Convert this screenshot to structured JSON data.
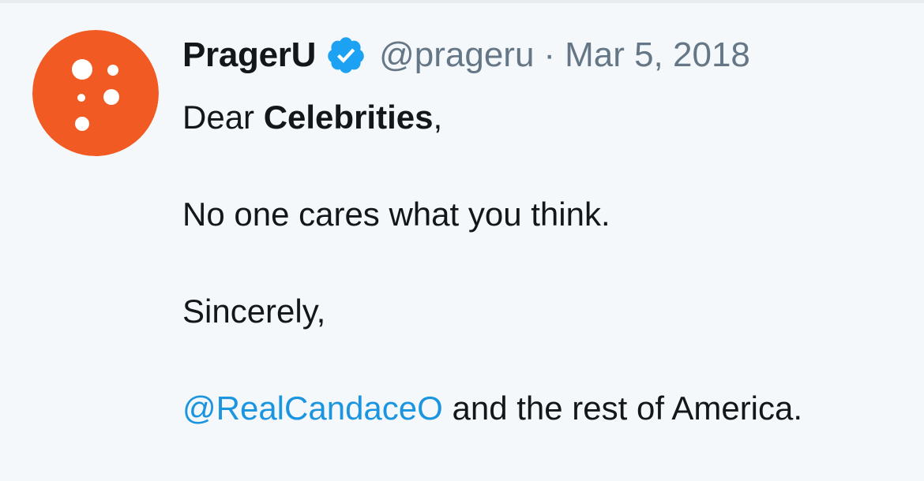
{
  "tweet": {
    "author": {
      "display_name": "PragerU",
      "handle": "@prageru",
      "verified": true,
      "verified_icon": "verified-badge-icon",
      "avatar_icon": "prageru-logo-icon",
      "avatar_color": "#f15a22"
    },
    "separator": "·",
    "date": "Mar 5, 2018",
    "body": {
      "line1_prefix": "Dear ",
      "line1_bold": "Celebrities",
      "line1_suffix": ",",
      "line2": "No one cares what you think.",
      "line3": "Sincerely,",
      "line4_mention": "@RealCandaceO",
      "line4_suffix": " and the rest of America."
    }
  },
  "colors": {
    "background": "#f5f8fa",
    "text": "#14171a",
    "secondary_text": "#657786",
    "link": "#1b95e0",
    "verified": "#1da1f2",
    "avatar": "#f15a22"
  }
}
